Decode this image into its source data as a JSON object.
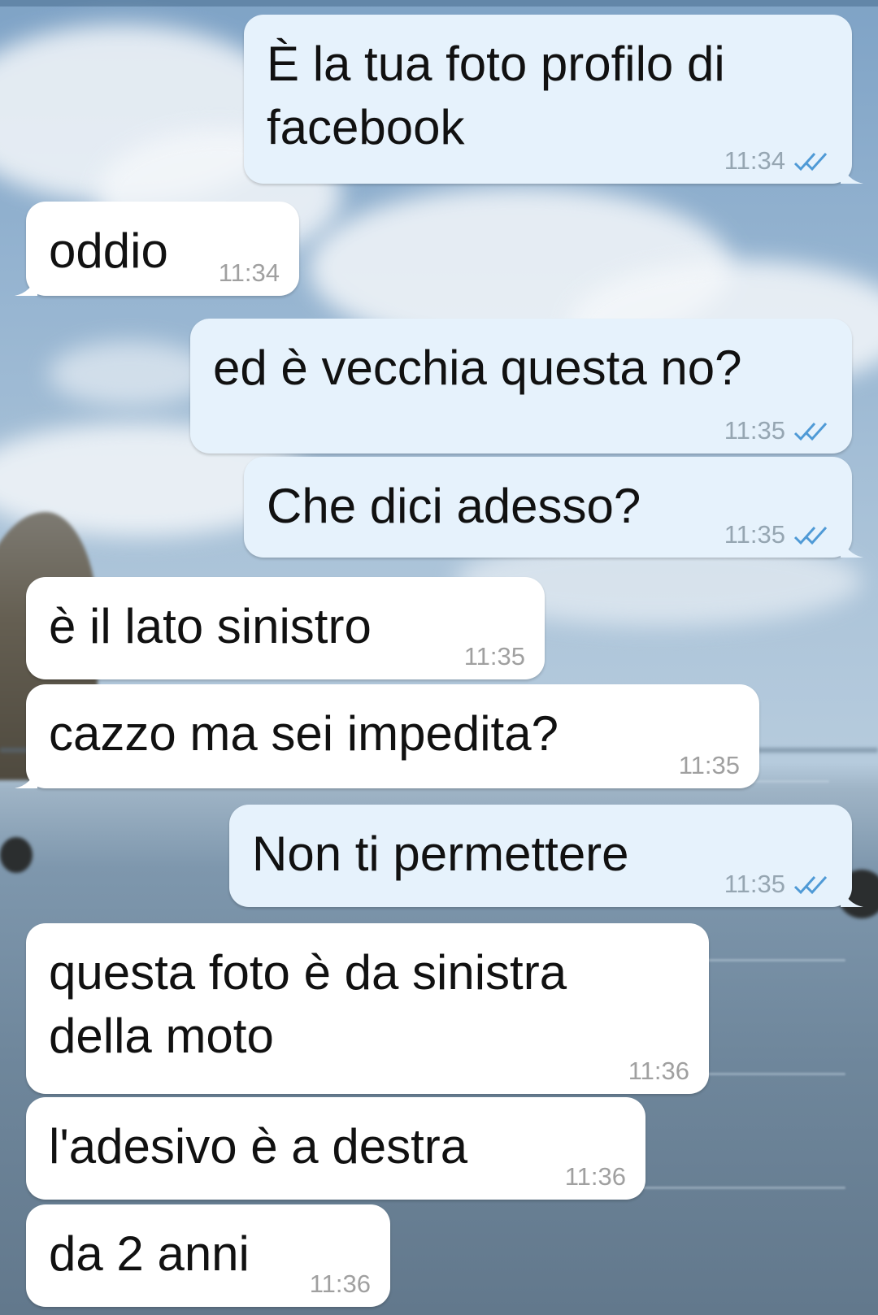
{
  "messages": [
    {
      "text": "È la tua foto profilo di\nfacebook",
      "time": "11:34",
      "dir": "out",
      "ticks": "double-check-icon"
    },
    {
      "text": "oddio",
      "time": "11:34",
      "dir": "in"
    },
    {
      "text": "ed è vecchia questa no?",
      "time": "11:35",
      "dir": "out",
      "ticks": "double-check-icon"
    },
    {
      "text": "Che dici adesso?",
      "time": "11:35",
      "dir": "out",
      "ticks": "double-check-icon"
    },
    {
      "text": "è il lato sinistro",
      "time": "11:35",
      "dir": "in"
    },
    {
      "text": "cazzo ma sei impedita?",
      "time": "11:35",
      "dir": "in"
    },
    {
      "text": "Non ti permettere",
      "time": "11:35",
      "dir": "out",
      "ticks": "double-check-icon"
    },
    {
      "text": "questa foto è da sinistra\ndella moto",
      "time": "11:36",
      "dir": "in"
    },
    {
      "text": "l'adesivo è a destra",
      "time": "11:36",
      "dir": "in"
    },
    {
      "text": "da 2 anni",
      "time": "11:36",
      "dir": "in"
    }
  ],
  "colors": {
    "outgoing_bubble": "#e6f2fc",
    "incoming_bubble": "#ffffff",
    "read_ticks": "#4f9ad6"
  }
}
